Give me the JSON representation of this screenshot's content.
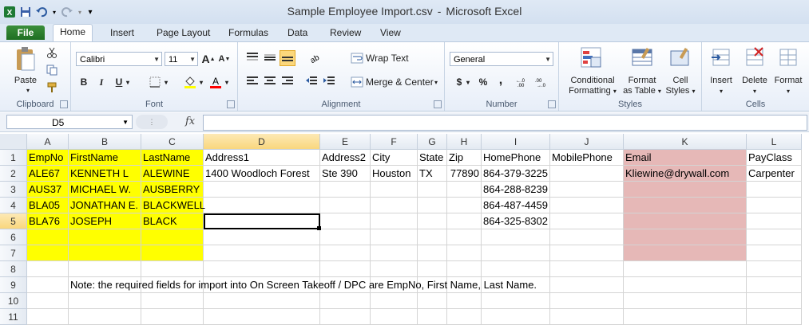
{
  "window": {
    "title": "Sample Employee Import.csv",
    "separator": "-",
    "app": "Microsoft Excel"
  },
  "tabs": [
    "File",
    "Home",
    "Insert",
    "Page Layout",
    "Formulas",
    "Data",
    "Review",
    "View"
  ],
  "ribbon": {
    "clipboard": {
      "label": "Clipboard",
      "paste": "Paste"
    },
    "font": {
      "label": "Font",
      "name": "Calibri",
      "size": "11",
      "grow": "A",
      "shrink": "A",
      "bold": "B",
      "italic": "I",
      "underline": "U"
    },
    "alignment": {
      "label": "Alignment",
      "wrap_text": "Wrap Text",
      "merge_center": "Merge & Center"
    },
    "number": {
      "label": "Number",
      "format": "General",
      "currency": "$",
      "percent": "%",
      "comma": ","
    },
    "styles": {
      "label": "Styles",
      "conditional": [
        "Conditional",
        "Formatting"
      ],
      "format_table": [
        "Format",
        "as Table"
      ],
      "cell_styles": [
        "Cell",
        "Styles"
      ]
    },
    "cells": {
      "label": "Cells",
      "insert": "Insert",
      "delete": "Delete",
      "format": "Format"
    }
  },
  "formula_bar": {
    "name_box": "D5",
    "fx": "fx",
    "formula": ""
  },
  "columns": [
    "A",
    "B",
    "C",
    "D",
    "E",
    "F",
    "G",
    "H",
    "I",
    "J",
    "K",
    "L"
  ],
  "active_column": "D",
  "active_row": "5",
  "rows": [
    "1",
    "2",
    "3",
    "4",
    "5",
    "6",
    "7",
    "8",
    "9",
    "10",
    "11"
  ],
  "cells": {
    "A1": "EmpNo",
    "B1": "FirstName",
    "C1": "LastName",
    "D1": "Address1",
    "E1": "Address2",
    "F1": "City",
    "G1": "State",
    "H1": "Zip",
    "I1": "HomePhone",
    "J1": "MobilePhone",
    "K1": "Email",
    "L1": "PayClass",
    "A2": "ALE67",
    "B2": "KENNETH L",
    "C2": "ALEWINE",
    "D2": "1400 Woodloch Forest",
    "E2": "Ste 390",
    "F2": "Houston",
    "G2": "TX",
    "H2": "77890",
    "I2": "864-379-3225",
    "K2": "Kliewine@drywall.com",
    "L2": "Carpenter",
    "A3": "AUS37",
    "B3": "MICHAEL W.",
    "C3": "AUSBERRY",
    "I3": "864-288-8239",
    "A4": "BLA05",
    "B4": "JONATHAN E.",
    "C4": "BLACKWELL",
    "I4": "864-487-4459",
    "A5": "BLA76",
    "B5": "JOSEPH",
    "C5": "BLACK",
    "I5": "864-325-8302",
    "B9": "Note: the required fields for import into On Screen Takeoff / DPC are EmpNo, First Name, Last Name."
  },
  "colors": {
    "yellow": "#ffff00",
    "pink": "#e6b8b7",
    "file_tab": "#2a7d2e"
  }
}
